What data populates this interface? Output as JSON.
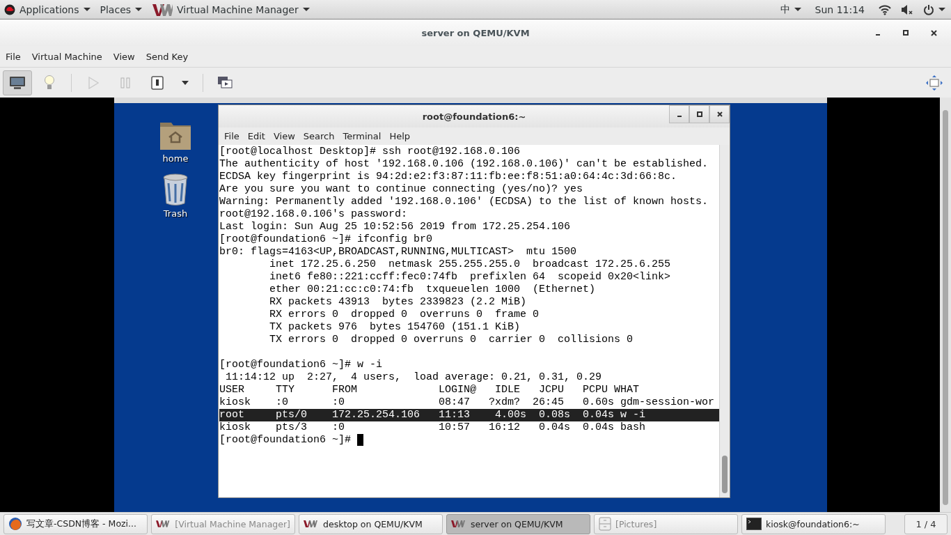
{
  "top_bar": {
    "menus": [
      {
        "kind": "applications",
        "label": "Applications"
      },
      {
        "kind": "places",
        "label": "Places"
      },
      {
        "kind": "app",
        "label": "Virtual Machine Manager"
      }
    ],
    "input_method": "中",
    "clock": "Sun 11:14",
    "volume_muted": true
  },
  "window": {
    "title": "server on QEMU/KVM",
    "menu": [
      "File",
      "Virtual Machine",
      "View",
      "Send Key"
    ],
    "toolbar": [
      {
        "kind": "console",
        "selected": true,
        "disabled": false
      },
      {
        "kind": "details",
        "selected": false,
        "disabled": false
      },
      {
        "kind": "run",
        "selected": false,
        "disabled": true
      },
      {
        "kind": "pause",
        "selected": false,
        "disabled": true
      },
      {
        "kind": "shutdown",
        "selected": false,
        "disabled": false
      },
      {
        "kind": "dropdown",
        "selected": false,
        "disabled": false
      },
      {
        "kind": "snapshots",
        "selected": false,
        "disabled": false
      }
    ]
  },
  "guest_desktop": {
    "icons": [
      {
        "kind": "home",
        "label": "home"
      },
      {
        "kind": "trash",
        "label": "Trash"
      }
    ],
    "terminal": {
      "title": "root@foundation6:~",
      "menu": [
        "File",
        "Edit",
        "View",
        "Search",
        "Terminal",
        "Help"
      ],
      "cursor": true,
      "blocks": [
        [
          {
            "text": "[root@localhost Desktop]# ssh root@192.168.0.106",
            "highlighted": false
          },
          {
            "text": "The authenticity of host '192.168.0.106 (192.168.0.106)' can't be established.",
            "highlighted": false
          },
          {
            "text": "ECDSA key fingerprint is 94:2d:e2:f3:87:11:fb:ee:f8:51:a0:64:4c:3d:66:8c.",
            "highlighted": false
          },
          {
            "text": "Are you sure you want to continue connecting (yes/no)? yes",
            "highlighted": false
          },
          {
            "text": "Warning: Permanently added '192.168.0.106' (ECDSA) to the list of known hosts.",
            "highlighted": false
          },
          {
            "text": "root@192.168.0.106's password:",
            "highlighted": false
          },
          {
            "text": "Last login: Sun Aug 25 10:52:56 2019 from 172.25.254.106",
            "highlighted": false
          },
          {
            "text": "[root@foundation6 ~]# ifconfig br0",
            "highlighted": false
          },
          {
            "text": "br0: flags=4163<UP,BROADCAST,RUNNING,MULTICAST>  mtu 1500",
            "highlighted": false
          },
          {
            "text": "        inet 172.25.6.250  netmask 255.255.255.0  broadcast 172.25.6.255",
            "highlighted": false
          },
          {
            "text": "        inet6 fe80::221:ccff:fec0:74fb  prefixlen 64  scopeid 0x20<link>",
            "highlighted": false
          },
          {
            "text": "        ether 00:21:cc:c0:74:fb  txqueuelen 1000  (Ethernet)",
            "highlighted": false
          },
          {
            "text": "        RX packets 43913  bytes 2339823 (2.2 MiB)",
            "highlighted": false
          },
          {
            "text": "        RX errors 0  dropped 0  overruns 0  frame 0",
            "highlighted": false
          },
          {
            "text": "        TX packets 976  bytes 154760 (151.1 KiB)",
            "highlighted": false
          },
          {
            "text": "        TX errors 0  dropped 0 overruns 0  carrier 0  collisions 0",
            "highlighted": false
          }
        ],
        [
          {
            "text": "[root@foundation6 ~]# w -i",
            "highlighted": false
          },
          {
            "text": " 11:14:12 up  2:27,  4 users,  load average: 0.21, 0.31, 0.29",
            "highlighted": false
          },
          {
            "text": "USER     TTY      FROM             LOGIN@   IDLE   JCPU   PCPU WHAT",
            "highlighted": false
          },
          {
            "text": "kiosk    :0       :0               08:47   ?xdm?  26:45   0.60s gdm-session-wor",
            "highlighted": false
          },
          {
            "text": "root     pts/0    172.25.254.106   11:13    4.00s  0.08s  0.04s w -i",
            "highlighted": true
          },
          {
            "text": "kiosk    pts/3    :0               10:57   16:12   0.04s  0.04s bash",
            "highlighted": false
          },
          {
            "text": "[root@foundation6 ~]# ",
            "highlighted": false
          }
        ]
      ]
    }
  },
  "taskbar": {
    "items": [
      {
        "kind": "browser",
        "label": "写文章-CSDN博客 - Mozi...",
        "selected": false,
        "minimized": false
      },
      {
        "kind": "vm",
        "label": "[Virtual Machine Manager]",
        "selected": false,
        "minimized": true
      },
      {
        "kind": "vm",
        "label": "desktop on QEMU/KVM",
        "selected": false,
        "minimized": false
      },
      {
        "kind": "vm",
        "label": "server on QEMU/KVM",
        "selected": true,
        "minimized": false
      },
      {
        "kind": "files",
        "label": "[Pictures]",
        "selected": false,
        "minimized": true
      },
      {
        "kind": "terminal",
        "label": "kiosk@foundation6:~",
        "selected": false,
        "minimized": false
      }
    ],
    "workspace": "1 / 4"
  }
}
